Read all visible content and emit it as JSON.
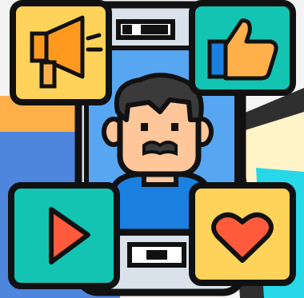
{
  "illustration": {
    "theme": "social media marketing",
    "icons": [
      {
        "name": "megaphone-icon",
        "tile_color": "#ffd35a"
      },
      {
        "name": "thumbs-up-icon",
        "tile_color": "#12c4b1"
      },
      {
        "name": "play-icon",
        "tile_color": "#12c4b1"
      },
      {
        "name": "heart-icon",
        "tile_color": "#ffd35a"
      }
    ],
    "colors": {
      "outline": "#111111",
      "phone_screen": "#57a6f2",
      "phone_body": "#d9e1ea",
      "accent_orange": "#ff9a1f",
      "accent_red": "#ff5a3c",
      "skin": "#ffc69a",
      "hair": "#3a3a3a",
      "shirt": "#1b7fe0",
      "bg_orange": "#ffb04a",
      "bg_blue": "#4e86de",
      "bg_dark": "#2f2f2f",
      "bg_cream": "#fff4c7",
      "bg_cyan": "#26d8e8"
    }
  }
}
